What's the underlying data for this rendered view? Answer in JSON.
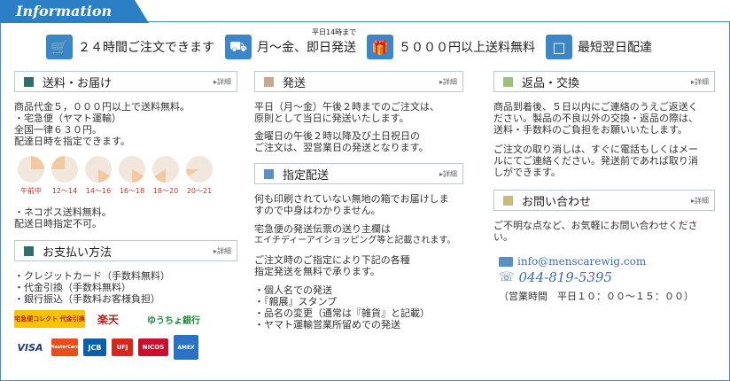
{
  "tab": {
    "title": "Information"
  },
  "features": [
    {
      "icon": "cart-icon",
      "text": "２４時間ご注文できます"
    },
    {
      "icon": "truck-icon",
      "text": "月～金、即日発送",
      "small": "平日14時まで"
    },
    {
      "icon": "gift-icon",
      "text": "５０００円以上送料無料"
    },
    {
      "icon": "box-icon",
      "text": "最短翌日配達"
    }
  ],
  "more_label": "詳細",
  "shipping": {
    "title": "送料・お届け",
    "lines": [
      "商品代金５，０００円以上で送料無料。",
      "・宅急便（ヤマト運輸）",
      "全国一律６３０円。",
      "配達日時を指定できます。"
    ],
    "slots": [
      "午前中",
      "12～14",
      "14～16",
      "16～18",
      "18～20",
      "20～21"
    ],
    "after": [
      "・ネコポス送料無料。",
      "配送日時指定不可。"
    ]
  },
  "payment": {
    "title": "お支払い方法",
    "lines": [
      "・クレジットカード（手数料無料）",
      "・代金引換（手数料無料）",
      "・銀行振込（手数料お客様負担）"
    ],
    "logos_row1": [
      "宅急便コレクト 代金引換",
      "楽天",
      "ゆうちょ銀行"
    ],
    "logos_row2": [
      "VISA",
      "MasterCard",
      "JCB",
      "UFJ",
      "NICOS",
      "AMEX"
    ]
  },
  "dispatch": {
    "title": "発送",
    "p1": [
      "平日（月～金）午後２時までのご注文は、",
      "原則として当日に発送いたします。"
    ],
    "p2": [
      "金曜日の午後２時以降及び土日祝日の",
      "ご注文は、翌営業日の発送となります。"
    ]
  },
  "designated": {
    "title": "指定配送",
    "p1": [
      "何も印刷されていない無地の箱でお届けしま",
      "すので中身はわかりません。"
    ],
    "p2": [
      "宅急便の発送伝票の送り主欄は",
      "エイチディーアイショッピング等と記載されます。"
    ],
    "p3": [
      "ご注文時のご指定により下記の各種",
      "指定発送を無料で承ります。"
    ],
    "list": [
      "・個人名での発送",
      "・『親展』スタンプ",
      "・品名の変更（通常は『雑貨』と記載）",
      "・ヤマト運輸営業所留めでの発送"
    ]
  },
  "returns": {
    "title": "返品・交換",
    "p1": [
      "商品到着後、５日以内にご連絡のうえご返送く",
      "ださい。製品の不良以外の交換・返品の際は、",
      "送料・手数料のご負担をお願いいたします。"
    ],
    "p2": [
      "ご注文の取り消しは、すぐに電話もしくはメー",
      "ルにてご連絡ください。発送前であれば取り消",
      "しができます。"
    ]
  },
  "contact": {
    "title": "お問い合わせ",
    "p1": [
      "ご不明な点など、お気軽にお問い合わせくださ",
      "い。"
    ],
    "email": "info@menscarewig.com",
    "phone": "044-819-5395",
    "hours": "（営業時間　平日１０：００～１５：００）"
  },
  "colors": {
    "accent": "#2b7fc4",
    "shipping": "#2e6f6a",
    "dispatch": "#c8a88a",
    "designated": "#5b8fc4",
    "returns": "#9bc27a",
    "contact": "#c9b97b"
  }
}
